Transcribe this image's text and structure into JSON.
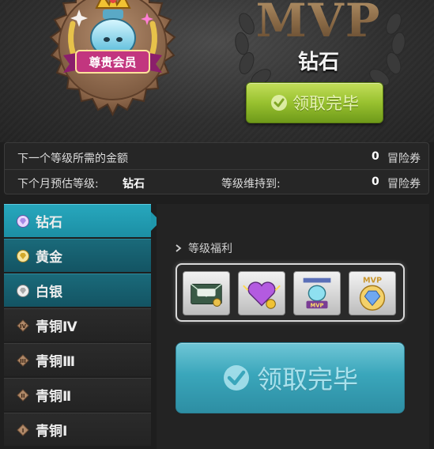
{
  "header": {
    "badge_text": "尊贵会员",
    "mvp_title": "MVP",
    "tier_name": "钻石",
    "claim_label": "领取完毕"
  },
  "info": {
    "next_level_label": "下一个等级所需的金额",
    "next_level_value": "0",
    "next_level_unit": "冒险券",
    "forecast_label": "下个月预估等级:",
    "forecast_value": "钻石",
    "maintain_label": "等级维持到:",
    "maintain_value": "0",
    "maintain_unit": "冒险券"
  },
  "tiers": [
    {
      "label": "钻石",
      "icon": "diamond-gem-icon"
    },
    {
      "label": "黄金",
      "icon": "gold-gem-icon"
    },
    {
      "label": "白银",
      "icon": "silver-gem-icon"
    },
    {
      "label": "青铜Ⅳ",
      "icon": "bronze-gem-icon"
    },
    {
      "label": "青铜Ⅲ",
      "icon": "bronze-gem-icon"
    },
    {
      "label": "青铜Ⅱ",
      "icon": "bronze-gem-icon"
    },
    {
      "label": "青铜Ⅰ",
      "icon": "bronze-gem-icon"
    }
  ],
  "panel": {
    "benefit_title": "等级福利",
    "claim_label": "领取完毕",
    "items": [
      "coupon-envelope-icon",
      "heart-medal-icon",
      "mvp-trophy-icon",
      "mvp-diamond-icon"
    ]
  },
  "colors": {
    "teal_active": "#1f97ac",
    "green_button": "#98c12f",
    "teal_button": "#3aa6bb"
  }
}
